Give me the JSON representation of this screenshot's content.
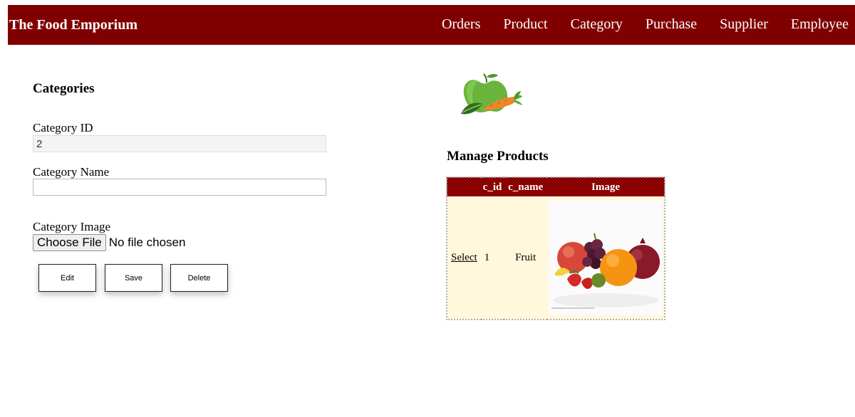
{
  "header": {
    "brand": "The Food Emporium",
    "nav": [
      {
        "label": "Orders"
      },
      {
        "label": "Product"
      },
      {
        "label": "Category"
      },
      {
        "label": "Purchase"
      },
      {
        "label": "Supplier"
      },
      {
        "label": "Employee"
      }
    ]
  },
  "form": {
    "title": "Categories",
    "category_id_label": "Category ID",
    "category_id_value": "2",
    "category_name_label": "Category Name",
    "category_name_value": "",
    "category_image_label": "Category Image",
    "choose_file_label": "Choose File",
    "file_status": "No file chosen",
    "buttons": {
      "edit": "Edit",
      "save": "Save",
      "delete": "Delete"
    }
  },
  "grid": {
    "title": "Manage Products",
    "columns": [
      "",
      "c_id",
      "c_name",
      "Image"
    ],
    "rows": [
      {
        "action": "Select",
        "c_id": "1",
        "c_name": "Fruit",
        "image_icon": "fruit-photo"
      }
    ]
  },
  "colors": {
    "header_bg": "#800000",
    "grid_header_bg": "#8b0000",
    "grid_row_bg": "#fff8dc"
  },
  "icons": {
    "logo": "apple-carrot-logo-icon"
  }
}
